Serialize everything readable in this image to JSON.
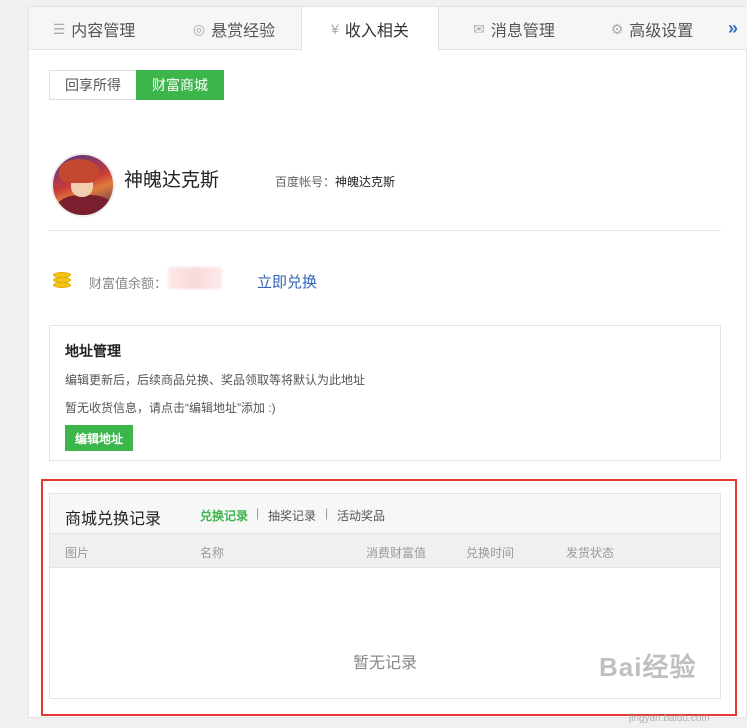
{
  "tabs": [
    {
      "label": "内容管理",
      "icon": "list-icon"
    },
    {
      "label": "悬赏经验",
      "icon": "coin-icon"
    },
    {
      "label": "收入相关",
      "icon": "yen-icon"
    },
    {
      "label": "消息管理",
      "icon": "mail-icon"
    },
    {
      "label": "高级设置",
      "icon": "gear-icon"
    }
  ],
  "tab_more": "»",
  "subtabs": [
    "回享所得",
    "财富商城"
  ],
  "profile": {
    "username": "神魄达克斯",
    "account_label": "百度帐号：",
    "account_value": "神魄达克斯"
  },
  "wealth": {
    "label": "财富值余额：",
    "exchange_link": "立即兑换"
  },
  "address": {
    "title": "地址管理",
    "line1": "编辑更新后，后续商品兑换、奖品领取等将默认为此地址",
    "line2": "暂无收货信息，请点击“编辑地址”添加 :)",
    "button": "编辑地址"
  },
  "records": {
    "title": "商城兑换记录",
    "tabs": [
      "兑换记录",
      "抽奖记录",
      "活动奖品"
    ],
    "separator": "|",
    "columns": [
      "图片",
      "名称",
      "消费财富值",
      "兑换时间",
      "发货状态"
    ],
    "empty_text": "暂无记录"
  },
  "watermark": {
    "text": "Bai经验",
    "sub": "jingyan.baidu.com"
  },
  "colors": {
    "accent_green": "#3cb54b",
    "link_blue": "#2d64b3",
    "highlight_red": "#e53935"
  }
}
